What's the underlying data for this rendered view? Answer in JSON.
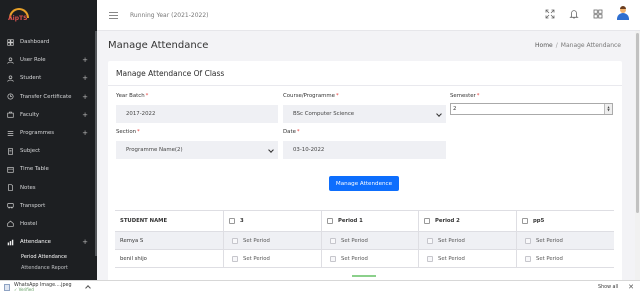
{
  "app": {
    "logo_text": "AipTS"
  },
  "sidebar": {
    "items": [
      {
        "label": "Dashboard",
        "icon": "dashboard-icon",
        "expandable": false
      },
      {
        "label": "User Role",
        "icon": "user-role-icon",
        "expandable": true
      },
      {
        "label": "Student",
        "icon": "student-icon",
        "expandable": true
      },
      {
        "label": "Transfer Certificate",
        "icon": "certificate-icon",
        "expandable": true
      },
      {
        "label": "Faculty",
        "icon": "faculty-icon",
        "expandable": true
      },
      {
        "label": "Programmes",
        "icon": "programmes-icon",
        "expandable": true
      },
      {
        "label": "Subject",
        "icon": "subject-icon",
        "expandable": false
      },
      {
        "label": "Time Table",
        "icon": "timetable-icon",
        "expandable": false
      },
      {
        "label": "Notes",
        "icon": "notes-icon",
        "expandable": false
      },
      {
        "label": "Transport",
        "icon": "transport-icon",
        "expandable": false
      },
      {
        "label": "Hostel",
        "icon": "hostel-icon",
        "expandable": false
      },
      {
        "label": "Attendance",
        "icon": "attendance-icon",
        "expandable": true
      }
    ],
    "sub_items": [
      {
        "label": "Period Attendance"
      },
      {
        "label": "Attendance Report"
      }
    ]
  },
  "topbar": {
    "running_year": "Running Year (2021-2022)",
    "icons": [
      "fullscreen-icon",
      "bell-icon",
      "apps-grid-icon",
      "user-avatar"
    ]
  },
  "page": {
    "title": "Manage Attendance",
    "breadcrumb": {
      "home": "Home",
      "separator": "/",
      "current": "Manage Attendance"
    }
  },
  "form": {
    "title": "Manage Attendance Of Class",
    "year_batch": {
      "label": "Year Batch",
      "value": "2017-2022"
    },
    "course": {
      "label": "Course/Programme",
      "value": "BSc Computer Science"
    },
    "semester": {
      "label": "Semester",
      "value": "2"
    },
    "section": {
      "label": "Section",
      "value": "Programme Name(2)"
    },
    "date": {
      "label": "Date",
      "value": "03-10-2022"
    },
    "required_mark": "*",
    "submit_label": "Manage Attendence"
  },
  "table": {
    "headers": [
      "STUDENT NAME",
      "3",
      "Period 1",
      "Period 2",
      "pp5"
    ],
    "rows": [
      {
        "name": "Remya S",
        "cells": [
          "Set Period",
          "Set Period",
          "Set Period",
          "Set Period"
        ]
      },
      {
        "name": "benil shijo",
        "cells": [
          "Set Period",
          "Set Period",
          "Set Period",
          "Set Period"
        ]
      }
    ]
  },
  "download_bar": {
    "file_name": "WhatsApp Image....jpeg",
    "status": "Verified",
    "show_all": "Show all",
    "close": "✕"
  },
  "colors": {
    "primary": "#0d6efd",
    "sidebar_bg": "#1d1f22",
    "required": "#e53935"
  }
}
